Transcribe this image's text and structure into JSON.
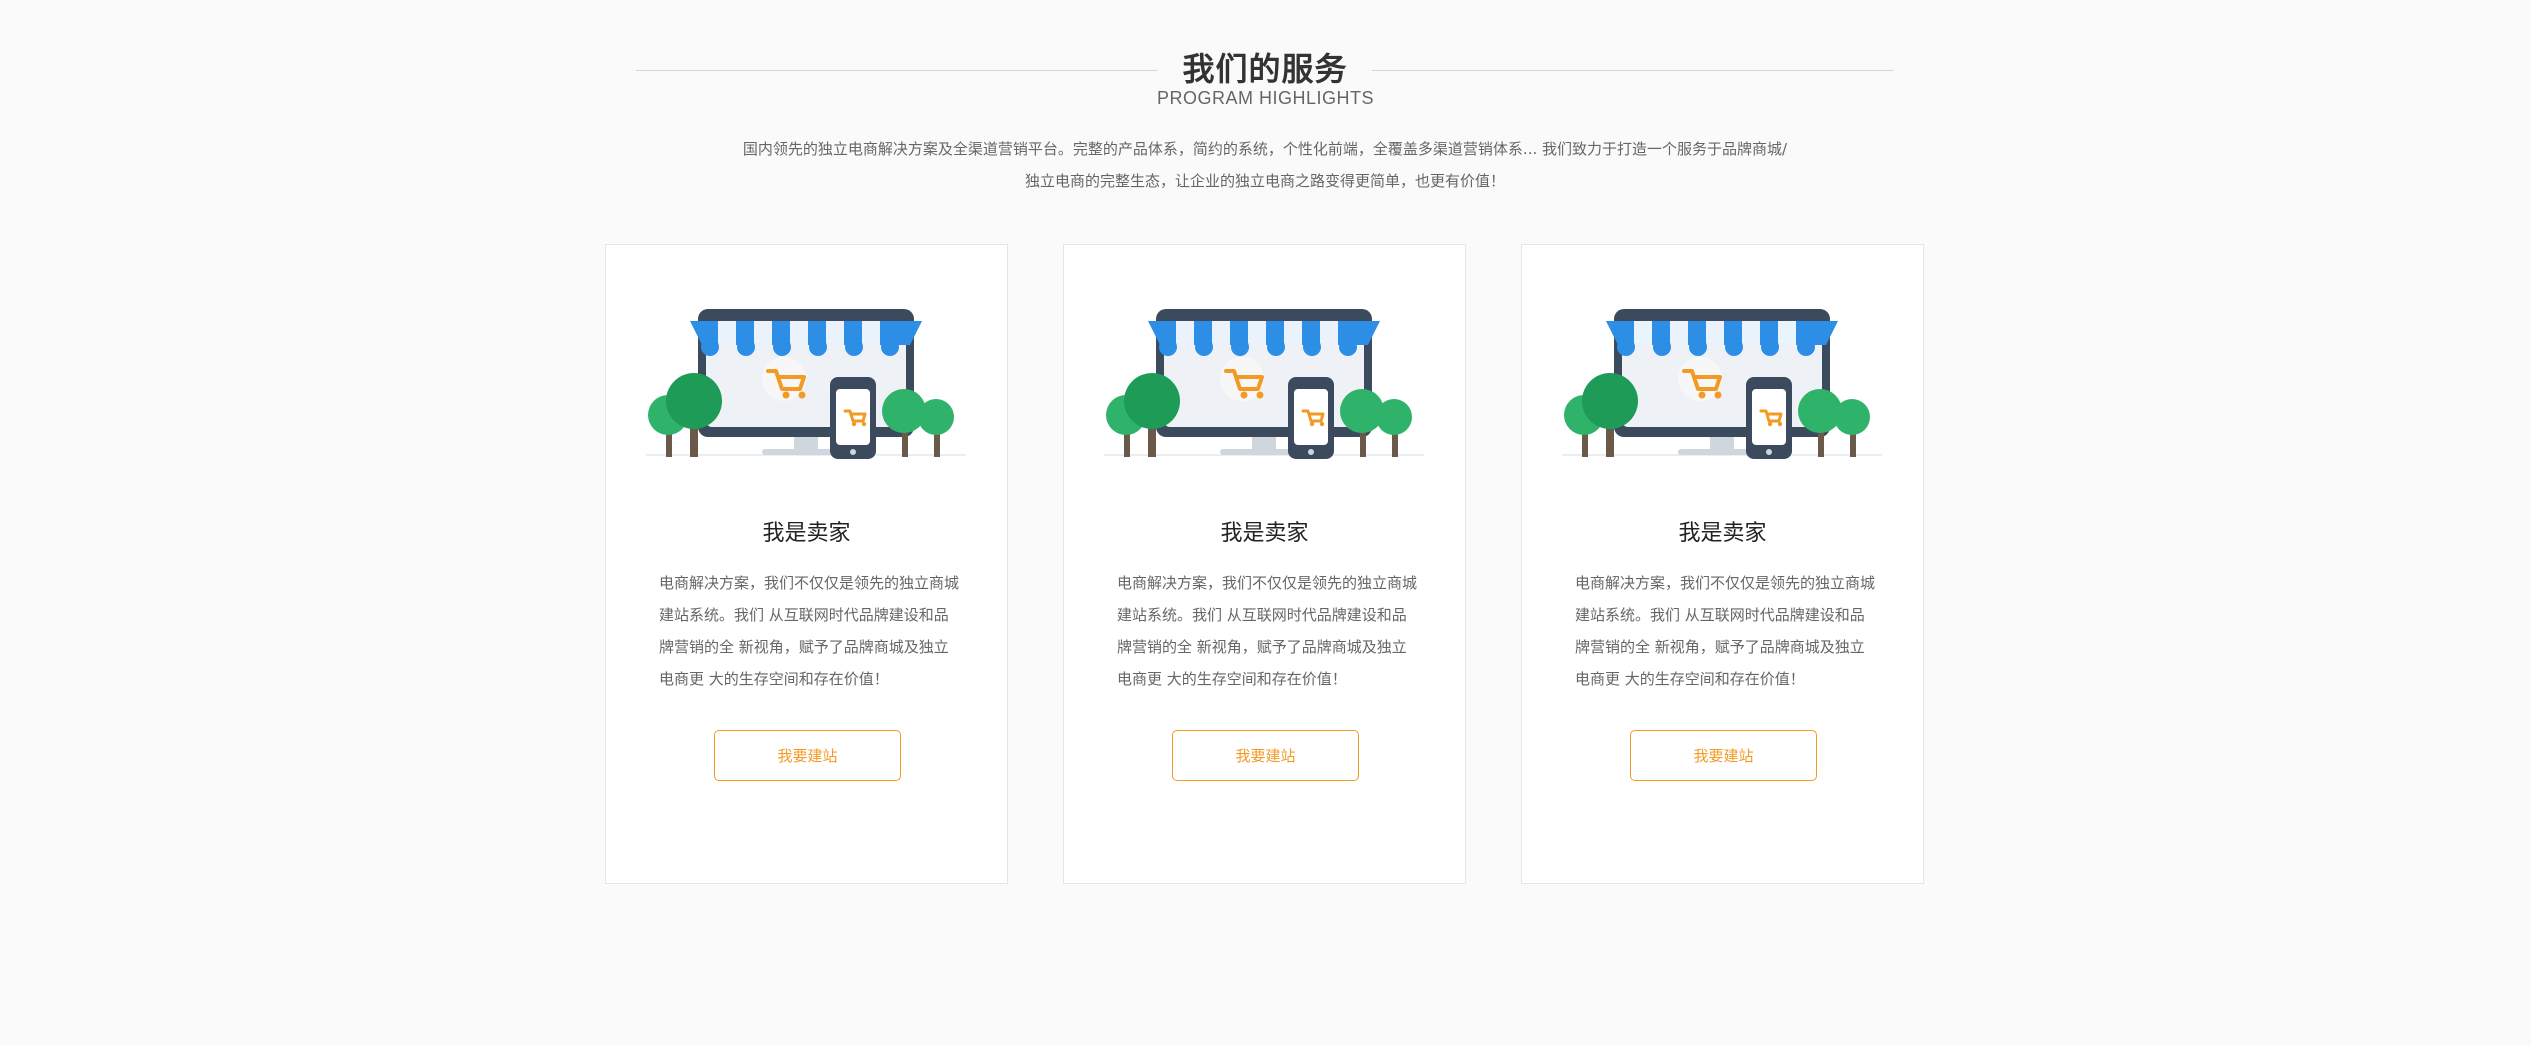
{
  "section": {
    "title": "我们的服务",
    "subtitle": "PROGRAM HIGHLIGHTS",
    "intro": "国内领先的独立电商解决方案及全渠道营销平台。完整的产品体系，简约的系统，个性化前端，全覆盖多渠道营销体系... 我们致力于打造一个服务于品牌商城/独立电商的完整生态，让企业的独立电商之路变得更简单，也更有价值！"
  },
  "cards": [
    {
      "title": "我是卖家",
      "text": "电商解决方案，我们不仅仅是领先的独立商城建站系统。我们 从互联网时代品牌建设和品牌营销的全 新视角，赋予了品牌商城及独立电商更 大的生存空间和存在价值！",
      "cta": "我要建站",
      "icon": "storefront-with-devices-icon"
    },
    {
      "title": "我是卖家",
      "text": "电商解决方案，我们不仅仅是领先的独立商城建站系统。我们 从互联网时代品牌建设和品牌营销的全 新视角，赋予了品牌商城及独立电商更 大的生存空间和存在价值！",
      "cta": "我要建站",
      "icon": "storefront-with-devices-icon"
    },
    {
      "title": "我是卖家",
      "text": "电商解决方案，我们不仅仅是领先的独立商城建站系统。我们 从互联网时代品牌建设和品牌营销的全 新视角，赋予了品牌商城及独立电商更 大的生存空间和存在价值！",
      "cta": "我要建站",
      "icon": "storefront-with-devices-icon"
    }
  ],
  "colors": {
    "background": "#fafafa",
    "accent": "#f39a25",
    "awning_blue": "#2d8ee6",
    "tree_green": "#2fb26a"
  }
}
